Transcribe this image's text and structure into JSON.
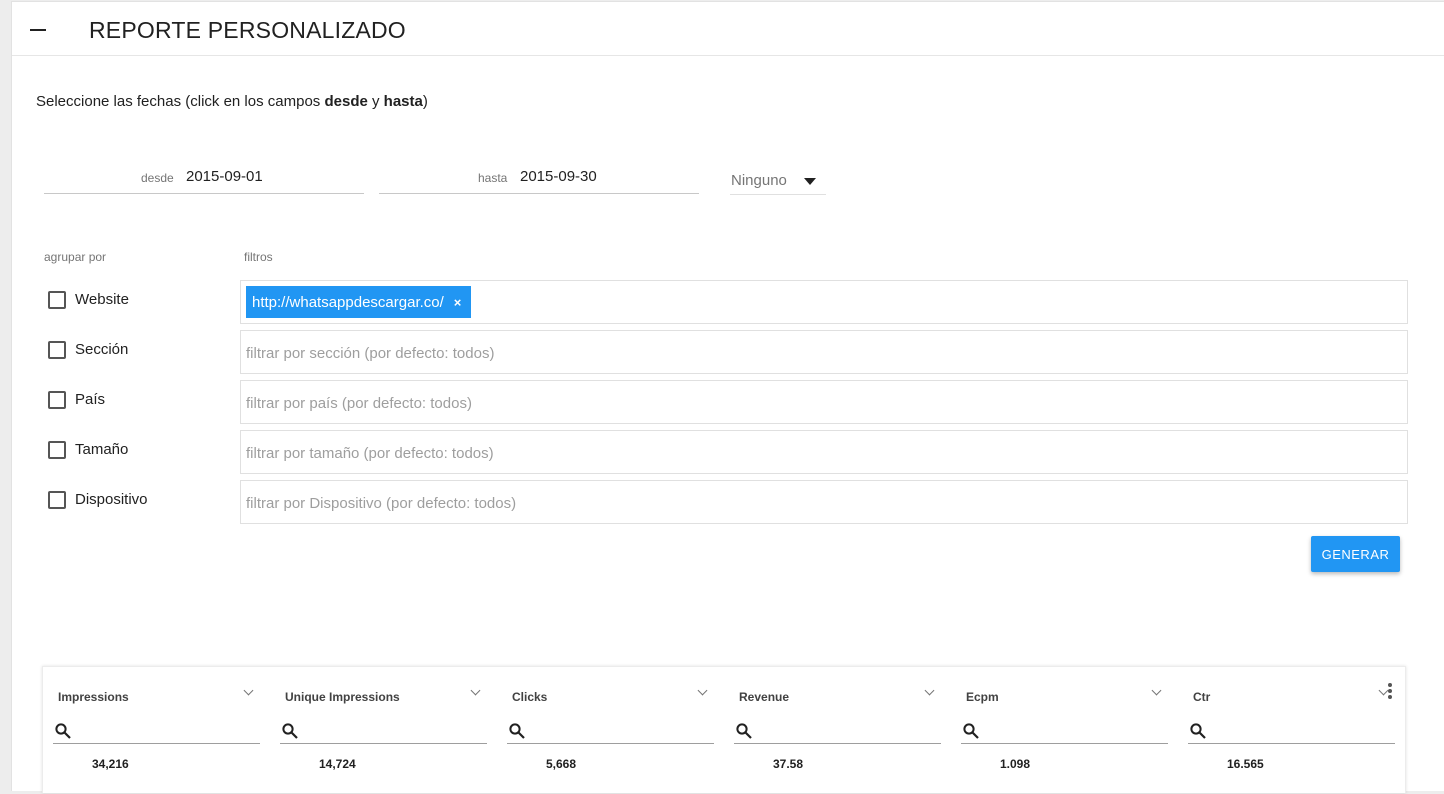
{
  "header": {
    "title": "REPORTE PERSONALIZADO",
    "collapse_icon": "minus-icon"
  },
  "instructions": {
    "prefix": "Seleccione las fechas (click en los campos ",
    "bold1": "desde",
    "middle": " y ",
    "bold2": "hasta",
    "suffix": ")"
  },
  "dates": {
    "from_label": "desde",
    "from_value": "2015-09-01",
    "to_label": "hasta",
    "to_value": "2015-09-30"
  },
  "preset_select": {
    "value": "Ninguno"
  },
  "groupby_label": "agrupar por",
  "filters_label": "filtros",
  "rows": [
    {
      "label": "Website",
      "checked": false,
      "chip": "http://whatsappdescargar.co/",
      "placeholder": ""
    },
    {
      "label": "Sección",
      "checked": false,
      "placeholder": "filtrar por sección (por defecto: todos)"
    },
    {
      "label": "País",
      "checked": false,
      "placeholder": "filtrar por país (por defecto: todos)"
    },
    {
      "label": "Tamaño",
      "checked": false,
      "placeholder": "filtrar por tamaño (por defecto: todos)"
    },
    {
      "label": "Dispositivo",
      "checked": false,
      "placeholder": "filtrar por Dispositivo (por defecto: todos)"
    }
  ],
  "chip_remove": "×",
  "generate_label": "GENERAR",
  "grid": {
    "columns": [
      {
        "header": "Impressions",
        "value": "34,216"
      },
      {
        "header": "Unique Impressions",
        "value": "14,724"
      },
      {
        "header": "Clicks",
        "value": "5,668"
      },
      {
        "header": "Revenue",
        "value": "37.58"
      },
      {
        "header": "Ecpm",
        "value": "1.098"
      },
      {
        "header": "Ctr",
        "value": "16.565"
      }
    ],
    "menu_icon": "kebab-menu-icon"
  },
  "colors": {
    "accent": "#2196f3",
    "text": "#212121",
    "muted": "#757575"
  }
}
